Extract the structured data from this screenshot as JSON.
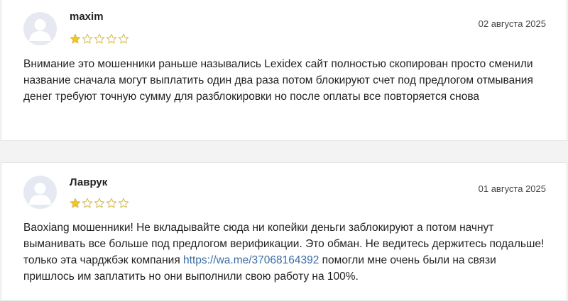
{
  "reviews": [
    {
      "author": "maxim",
      "date": "02 августа 2025",
      "rating": 1,
      "rating_max": 5,
      "text": "Внимание это мошенники раньше назывались Lexidex сайт полностью скопирован просто сменили название сначала могут выплатить один два раза потом блокируют счет под предлогом отмывания денег требуют точную сумму для разблокировки но после оплаты все повторяется снова"
    },
    {
      "author": "Лаврук",
      "date": "01 августа 2025",
      "rating": 1,
      "rating_max": 5,
      "text_before": "Baoxiang мошенники! Не вкладывайте сюда ни копейки деньги заблокируют а потом начнут выманивать все больше под предлогом верификации. Это обман. Не ведитесь держитесь подальше! только эта чарджбэк компания ",
      "link": "https://wa.me/37068164392",
      "text_after": " помогли мне очень были на связи пришлось им заплатить но они выполнили свою работу на 100%."
    }
  ],
  "colors": {
    "star_filled": "#f3c623",
    "star_outline": "#d4b94a",
    "avatar_bg": "#e6e9f2",
    "avatar_fg": "#ffffff",
    "link": "#3a6ea5"
  },
  "icons": {
    "avatar": "user-silhouette-icon",
    "star": "star-icon"
  }
}
